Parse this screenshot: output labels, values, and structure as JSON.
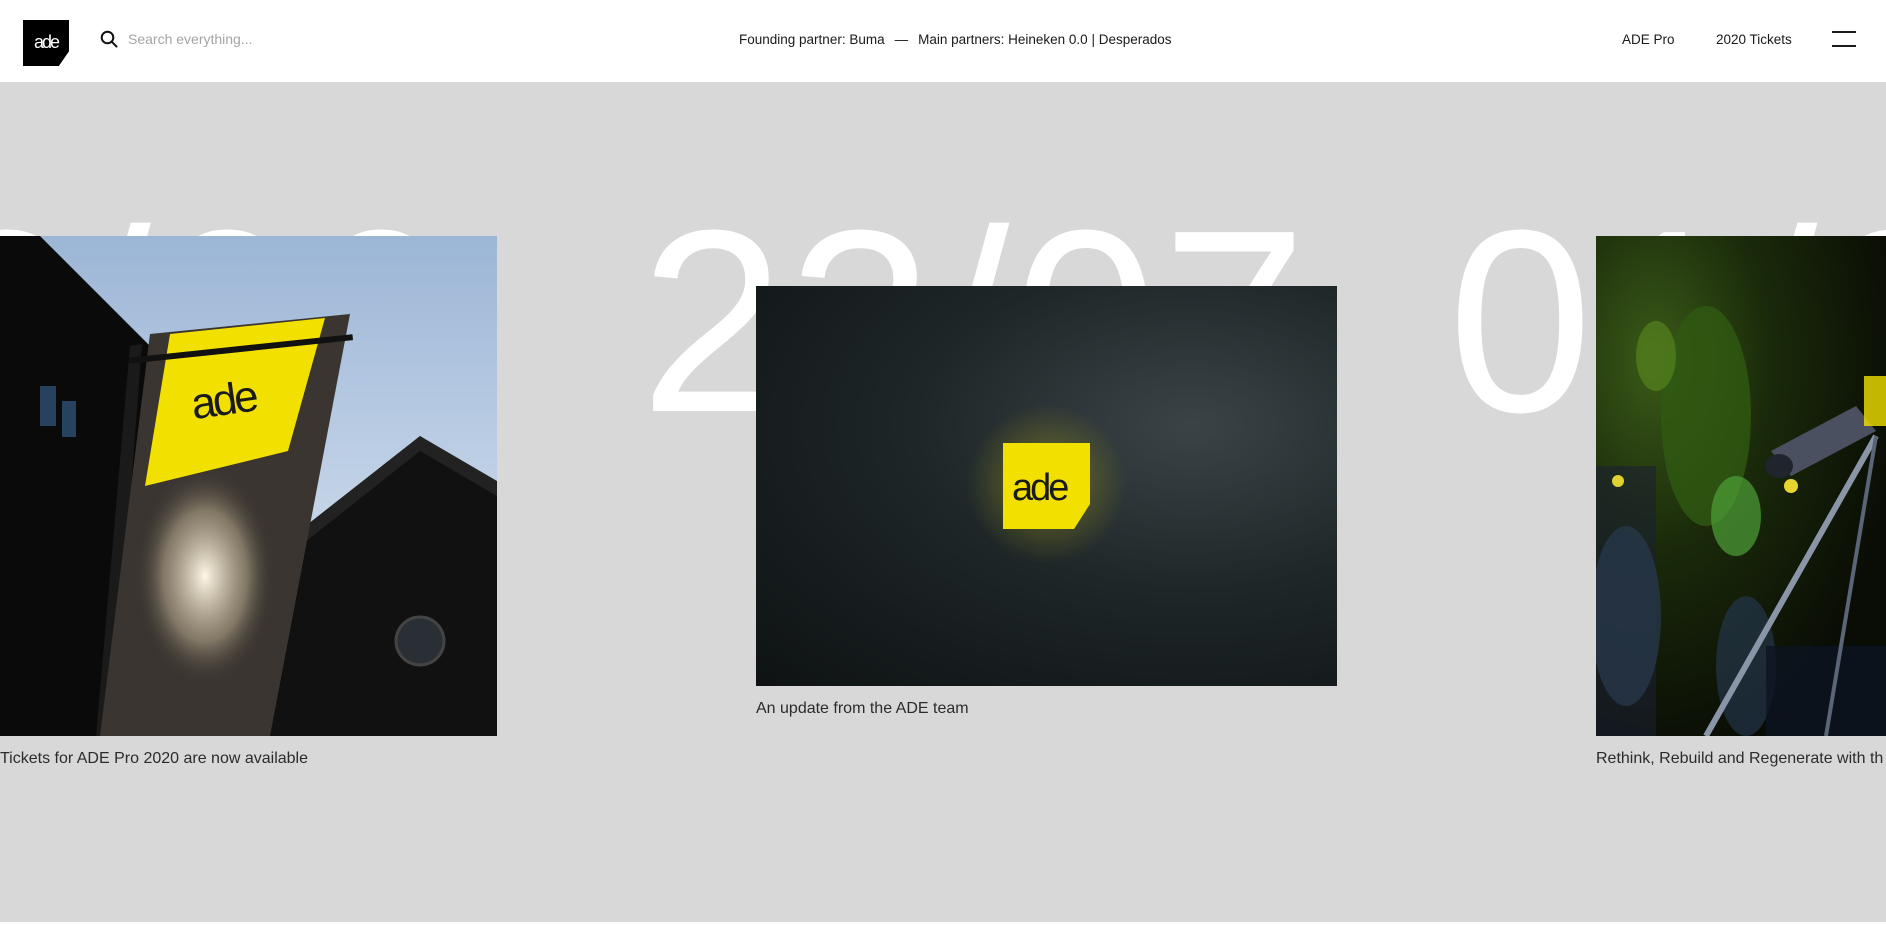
{
  "header": {
    "logo_text": "ade",
    "search": {
      "placeholder": "Search everything..."
    },
    "partners": {
      "founding": "Founding partner: Buma",
      "separator": "—",
      "main": "Main partners: Heineken 0.0 | Desperados"
    },
    "nav": {
      "pro_label": "ADE Pro",
      "tickets_label": "2020 Tickets"
    },
    "icons": {
      "search": "search-icon",
      "menu": "hamburger-menu-icon"
    }
  },
  "main": {
    "background": "#d8d8d8",
    "dates": {
      "left": "6/06",
      "middle": "23/07",
      "right": "01/0"
    },
    "cards": [
      {
        "caption": "Tickets for ADE Pro 2020 are now available"
      },
      {
        "caption": "An update from the ADE team"
      },
      {
        "caption": "Rethink, Rebuild and Regenerate with th"
      }
    ],
    "accent": "#f2e100"
  }
}
